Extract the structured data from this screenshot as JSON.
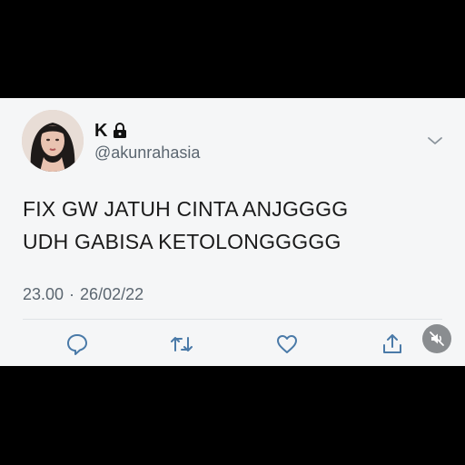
{
  "tweet": {
    "display_name": "K",
    "handle": "@akunrahasia",
    "text_lines": [
      "FIX GW JATUH CINTA ANJGGGG",
      "UDH GABISA KETOLONGGGGG"
    ],
    "time": "23.00",
    "separator": "·",
    "date": "26/02/22"
  },
  "icons": {
    "lock": "lock-icon",
    "more": "chevron-down-icon",
    "reply": "reply-icon",
    "retweet": "retweet-icon",
    "like": "heart-icon",
    "share": "share-icon",
    "mute": "mute-icon"
  },
  "colors": {
    "card_background": "#f5f6f7",
    "frame_background": "#000000",
    "text_primary": "#1a1a1a",
    "text_secondary": "#5b6670",
    "icon_color": "#4a7aa8"
  }
}
